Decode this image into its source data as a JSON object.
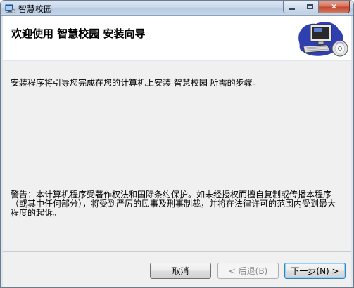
{
  "window": {
    "title": "智慧校园",
    "app_icon": "installer-icon",
    "minimize_icon": "minimize-icon",
    "maximize_icon": "maximize-icon",
    "close_glyph": "✕",
    "close_color": "#c14a30"
  },
  "banner": {
    "title": "欢迎使用 智慧校园 安装向导",
    "art_icon": "computer-with-disc-icon"
  },
  "content": {
    "intro": "安装程序将引导您完成在您的计算机上安装 智慧校园 所需的步骤。",
    "warning": "警告：本计算机程序受著作权法和国际条约保护。如未经授权而擅自复制或传播本程序（或其中任何部分），将受到严厉的民事及刑事制裁，并将在法律许可的范围内受到最大程度的起诉。"
  },
  "buttons": {
    "cancel": "取消",
    "back": "< 后退(B)",
    "next": "下一步(N) >",
    "back_enabled": false,
    "focus_color": "#3c7fb1"
  }
}
